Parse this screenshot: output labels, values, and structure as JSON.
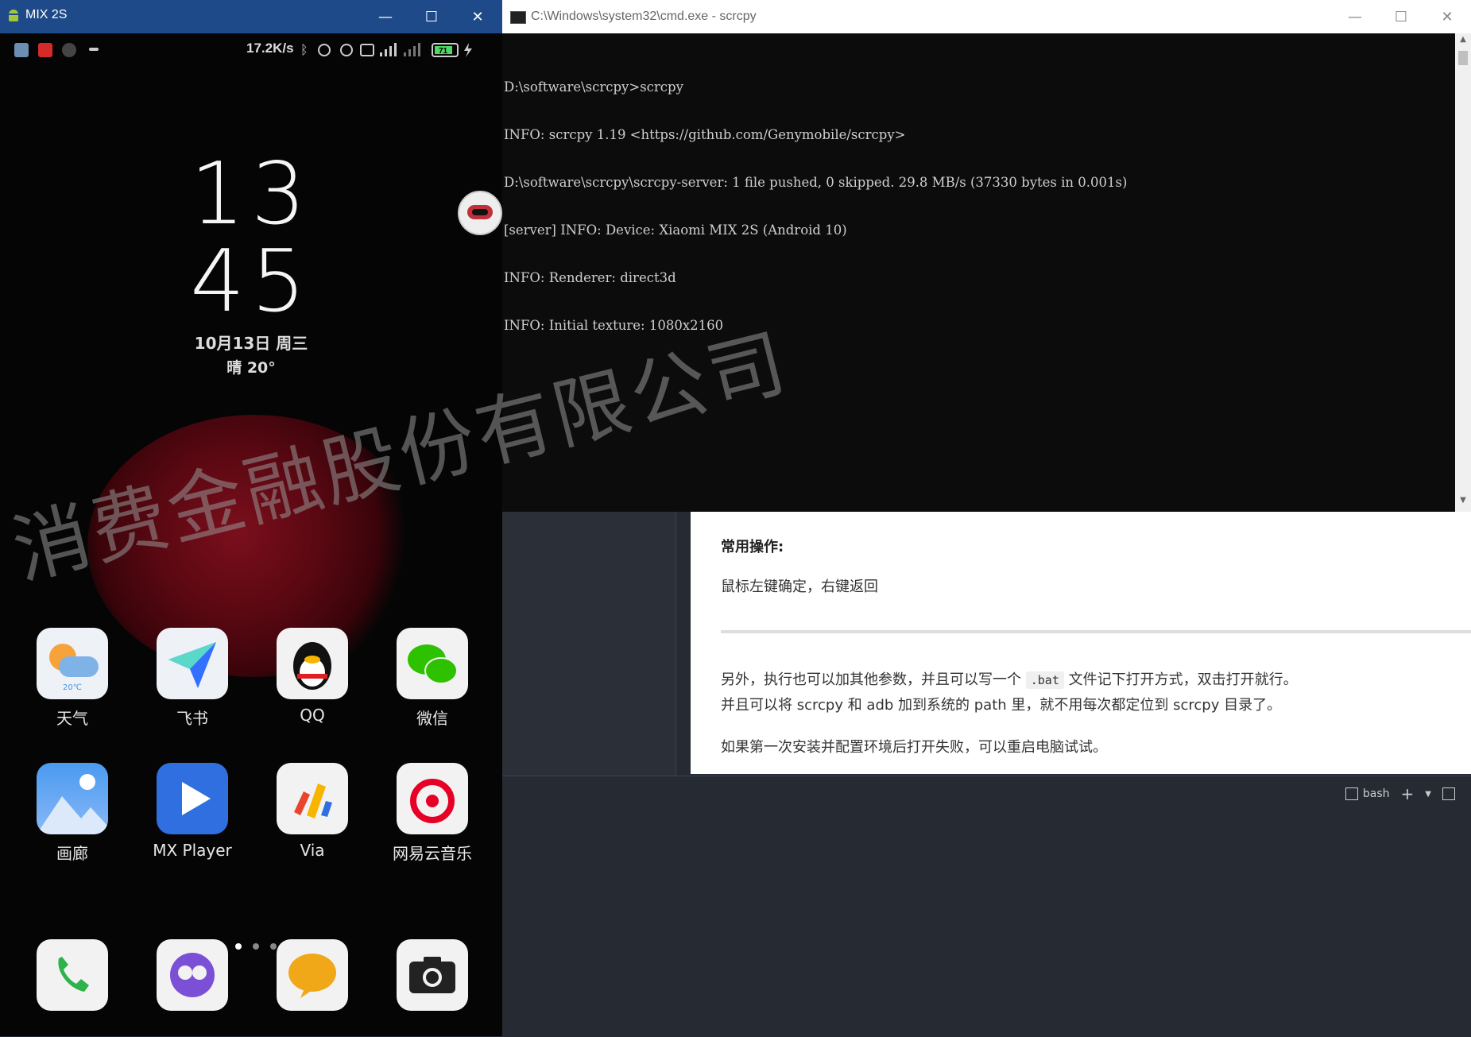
{
  "phone_window": {
    "title": "MIX 2S",
    "status": {
      "speed": "17.2K/s",
      "battery": "71"
    },
    "clock": {
      "hour": "13",
      "minute": "45"
    },
    "date": "10月13日 周三",
    "weather": "晴 20°",
    "apps_row1": [
      "天气",
      "飞书",
      "QQ",
      "微信"
    ],
    "apps_row2": [
      "画廊",
      "MX Player",
      "Via",
      "网易云音乐"
    ],
    "weather_icon_text": "20℃"
  },
  "cmd_window": {
    "title": "C:\\Windows\\system32\\cmd.exe - scrcpy",
    "lines": [
      "D:\\software\\scrcpy>scrcpy",
      "INFO: scrcpy 1.19 <https://github.com/Genymobile/scrcpy>",
      "D:\\software\\scrcpy\\scrcpy-server: 1 file pushed, 0 skipped. 29.8 MB/s (37330 bytes in 0.001s)",
      "[server] INFO: Device: Xiaomi MIX 2S (Android 10)",
      "INFO: Renderer: direct3d",
      "INFO: Initial texture: 1080x2160"
    ]
  },
  "preview": {
    "heading": "常用操作:",
    "p1": "鼠标左键确定，右键返回",
    "p2_before": "另外，执行也可以加其他参数，并且可以写一个 ",
    "p2_code": ".bat",
    "p2_after": " 文件记下打开方式，双击打开就行。",
    "p2_line2": "并且可以将 scrcpy 和 adb 加到系统的 path 里，就不用每次都定位到 scrcpy 目录了。",
    "p3": "如果第一次安装并配置环境后打开失败，可以重启电脑试试。"
  },
  "terminal": {
    "shell_label": "bash"
  },
  "watermark": "消费金融股份有限公司"
}
